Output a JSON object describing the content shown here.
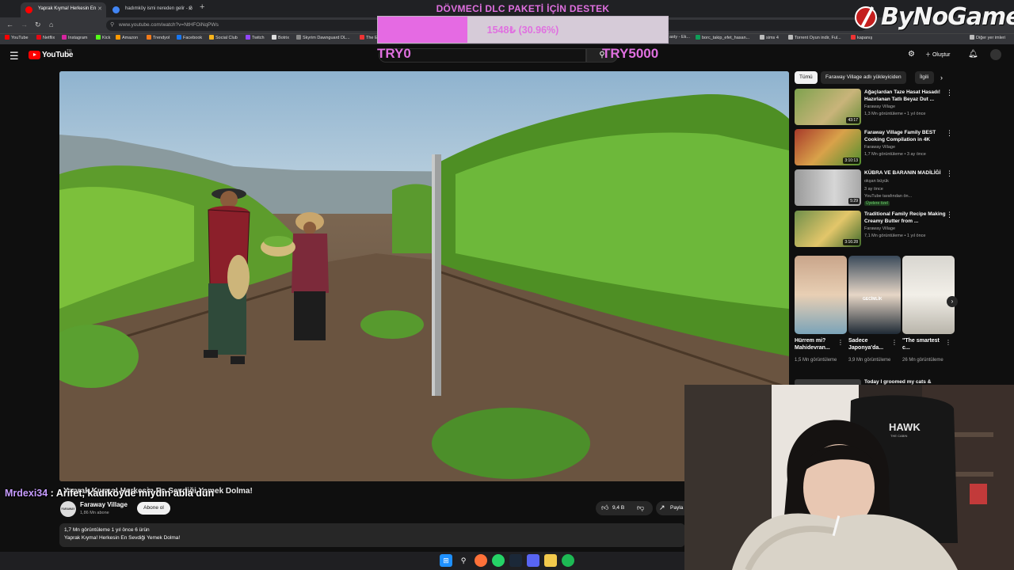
{
  "browser": {
    "tabs": [
      {
        "label": "Yaprak Kıyma! Herkesin En",
        "active": true
      },
      {
        "label": "hadımköy ismi nereden gelir - G",
        "active": false
      }
    ],
    "url": "www.youtube.com/watch?v=NtHFOiNqPWs",
    "bookmarks": [
      "YouTube",
      "Netflix",
      "Instagram",
      "Kick",
      "Amazon",
      "Trendyol",
      "Facebook",
      "Social Club",
      "Twitch",
      "Botrix",
      "Skyrim Dawnguard DL...",
      "The E",
      "asty - Ek...",
      "borc_takip_efet_hasan...",
      "sims 4",
      "Torrent Oyun indir, Ful...",
      "kapanış",
      "Diğer yer imleri"
    ]
  },
  "youtube": {
    "logo_text": "YouTube",
    "logo_sup": "TR",
    "create_label": "Oluştur"
  },
  "overlay": {
    "donation_title": "DÖVMECİ DLC PAKETİ İÇİN DESTEK",
    "donation_progress_text": "1548₺ (30.96%)",
    "donation_progress_fraction": 0.3096,
    "goal_start": "TRY0",
    "goal_end": "TRY5000",
    "brand_logo": "ByNoGame"
  },
  "chat": {
    "nick": "Mrdexi34",
    "separator": " : ",
    "message": "Arifet, kadıköyde miydin abla dün"
  },
  "video": {
    "title": "Yaprak Kıyma! Herkesin En Sevdiği Yemek Dolma!",
    "channel": "Faraway Village",
    "channel_avatar_text": "FARAWAY VILLAGE",
    "subscribers": "1,86 Mn abone",
    "subscribe_label": "Abone ol",
    "likes": "9,4 B",
    "share_label": "Payla",
    "stats": "1,7 Mn görüntüleme   1 yıl önce   6 ürün",
    "description": "Yaprak Kıyma! Herkesin En Sevdiği Yemek Dolma!"
  },
  "sidebar": {
    "chips": [
      "Tümü",
      "Faraway Village adlı yükleyiciden",
      "İlgili"
    ],
    "recommendations": [
      {
        "title": "Ağaçlardan Taze Hasat Hasadı! Hazırlanan Tatlı Beyaz Dut ...",
        "channel": "Faraway Village",
        "meta": "1,3 Mn görüntüleme • 1 yıl önce",
        "duration": "43:17"
      },
      {
        "title": "Faraway Village Family BEST Cooking Compilation in 4K",
        "channel": "Faraway Village",
        "meta": "1,7 Mn görüntüleme • 3 ay önce",
        "duration": "3:10:13"
      },
      {
        "title": "KÜBRA VE BARANIN MADİLİĞİ",
        "channel": "okşan büyük",
        "meta": "3 ay önce",
        "extra": "YouTube tarafından ön...",
        "badge": "Üyelere özel",
        "duration": "5:29"
      },
      {
        "title": "Traditional Family Recipe Making Creamy Butter from ...",
        "channel": "Faraway Village",
        "meta": "7,1 Mn görüntüleme • 1 yıl önce",
        "duration": "3:16:28"
      }
    ],
    "shorts": [
      {
        "title": "Hürrem mi? Mahidevran...",
        "views": "1,5 Mn görüntüleme"
      },
      {
        "title": "Sadece Japonya'da...",
        "views": "3,9 Mn görüntüleme"
      },
      {
        "title": "\"The smartest c...",
        "views": "26 Mn görüntüleme"
      }
    ],
    "short_caption": "GECİMLİK",
    "last_rec_title": "Today I groomed my cats &"
  },
  "webcam": {
    "chair_brand": "HAWK",
    "chair_sub": "THE CABIN"
  },
  "taskbar": {
    "icons": [
      "windows-icon",
      "search-icon",
      "firefox-icon",
      "whatsapp-icon",
      "steam-icon",
      "discord-icon",
      "files-icon",
      "spotify-icon"
    ]
  }
}
